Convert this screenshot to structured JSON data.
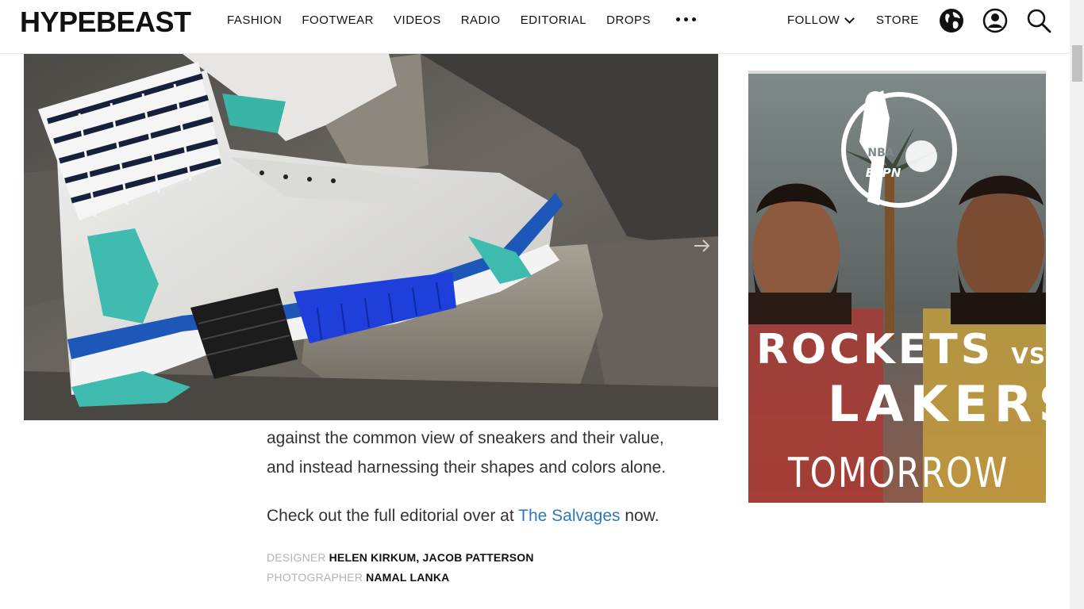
{
  "header": {
    "logo": "HYPEBEAST",
    "nav": [
      "FASHION",
      "FOOTWEAR",
      "VIDEOS",
      "RADIO",
      "EDITORIAL",
      "DROPS"
    ],
    "follow": "FOLLOW",
    "store": "STORE"
  },
  "article": {
    "para1_line1": "against the common view of sneakers and their value,",
    "para1_line2": "and instead harnessing their shapes and colors alone.",
    "para2_prefix": "Check out the full editorial over at ",
    "para2_link": "The Salvages",
    "para2_suffix": " now."
  },
  "credits": {
    "designer_label": "DESIGNER",
    "designer_value": "HELEN KIRKUM, JACOB PATTERSON",
    "photographer_label": "PHOTOGRAPHER",
    "photographer_value": "NAMAL LANKA"
  },
  "ad": {
    "badge": "NBA",
    "network": "ESPN",
    "line1": "ROCKETS",
    "vs": "VS",
    "line2": "LAKERS",
    "line3": "TOMORROW"
  },
  "colors": {
    "link": "#2e79b5",
    "credit_label": "#b3b3b3"
  }
}
